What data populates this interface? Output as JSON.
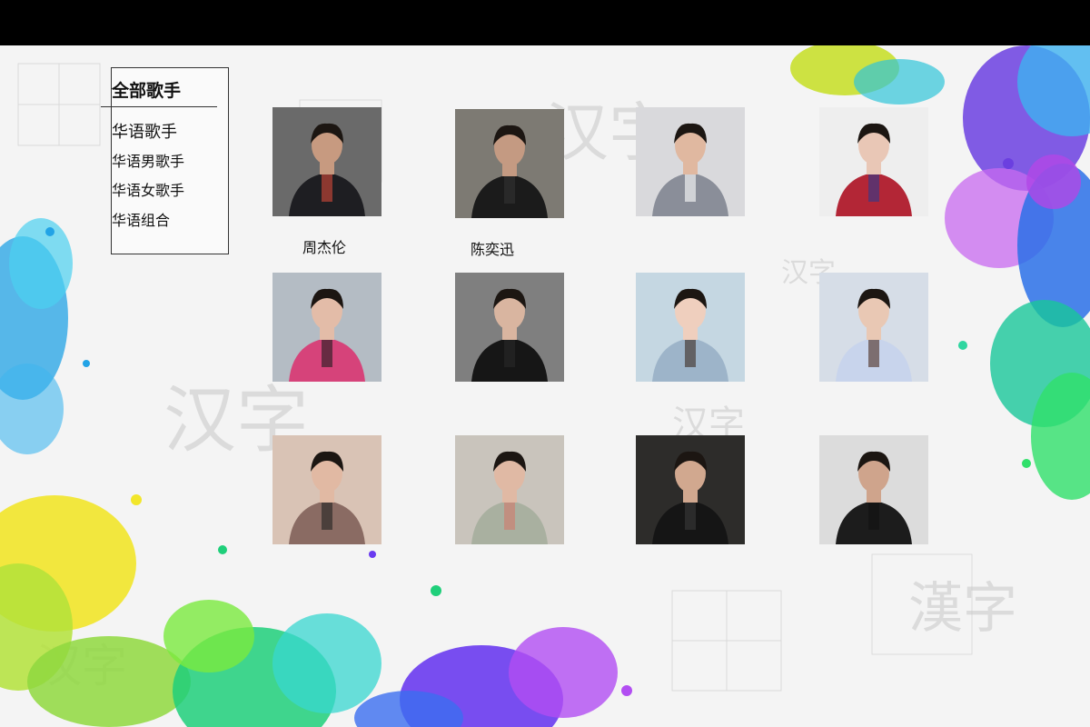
{
  "menu": {
    "heading": "全部歌手",
    "items": [
      "华语歌手",
      "华语男歌手",
      "华语女歌手",
      "华语组合"
    ]
  },
  "artists": [
    {
      "name": "周杰伦",
      "bg": "#6a6a6a",
      "fg": "#1e1e22",
      "skin": "#c79a80",
      "accent": "#d64a3a"
    },
    {
      "name": "陈奕迅",
      "bg": "#7d7a73",
      "fg": "#1b1b1b",
      "skin": "#c49a82",
      "accent": "#333333"
    },
    {
      "name": "",
      "bg": "#d9d9dc",
      "fg": "#8a8e99",
      "skin": "#e0b8a0",
      "accent": "#ffffff"
    },
    {
      "name": "",
      "bg": "#eeeeee",
      "fg": "#b32636",
      "skin": "#e9c7b6",
      "accent": "#2a3b8f"
    },
    {
      "name": "",
      "bg": "#b4bcc4",
      "fg": "#d6437a",
      "skin": "#e3bca8",
      "accent": "#1d1d1d"
    },
    {
      "name": "",
      "bg": "#7f7f7f",
      "fg": "#161616",
      "skin": "#d9b5a0",
      "accent": "#2a2a2a"
    },
    {
      "name": "",
      "bg": "#c5d7e2",
      "fg": "#9db4c9",
      "skin": "#efcfbe",
      "accent": "#3a2a22"
    },
    {
      "name": "",
      "bg": "#d6dde7",
      "fg": "#c8d4ec",
      "skin": "#e9c8b4",
      "accent": "#4a2a1e"
    },
    {
      "name": "",
      "bg": "#d9c3b5",
      "fg": "#8a6b63",
      "skin": "#e1b9a3",
      "accent": "#222222"
    },
    {
      "name": "",
      "bg": "#c9c4bc",
      "fg": "#a9b0a0",
      "skin": "#e0b9a4",
      "accent": "#d27a6a"
    },
    {
      "name": "",
      "bg": "#2d2c2a",
      "fg": "#151515",
      "skin": "#d1a88f",
      "accent": "#3b3b3b"
    },
    {
      "name": "",
      "bg": "#dcdcdc",
      "fg": "#1c1c1c",
      "skin": "#cfa48c",
      "accent": "#111111"
    }
  ]
}
